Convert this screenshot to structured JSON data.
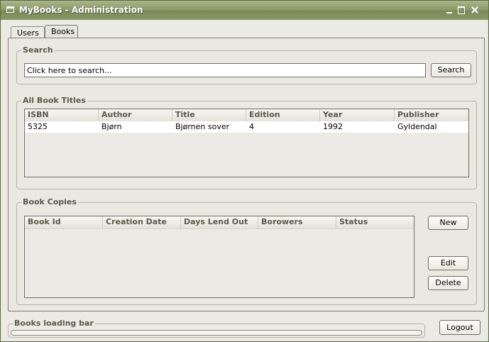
{
  "window": {
    "title": "MyBooks - Administration"
  },
  "tabs": [
    {
      "label": "Users"
    },
    {
      "label": "Books"
    }
  ],
  "search": {
    "group_title": "Search",
    "value": "Click here to search...",
    "button_label": "Search"
  },
  "book_titles": {
    "group_title": "All Book Titles",
    "columns": [
      "ISBN",
      "Author",
      "Title",
      "Edition",
      "Year",
      "Publisher"
    ],
    "rows": [
      [
        "5325",
        "Bjørn",
        "Bjørnen sover",
        "4",
        "1992",
        "Gyldendal"
      ]
    ]
  },
  "book_copies": {
    "group_title": "Book Copies",
    "columns": [
      "Book Id",
      "Creation Date",
      "Days Lend Out",
      "Borowers",
      "Status"
    ],
    "rows": [],
    "new_label": "New",
    "edit_label": "Edit",
    "delete_label": "Delete"
  },
  "loading": {
    "title": "Books loading bar",
    "progress": 0
  },
  "logout_label": "Logout",
  "colors": {
    "titlebar": "#8c9c6a",
    "accent": "#5a5a48"
  }
}
